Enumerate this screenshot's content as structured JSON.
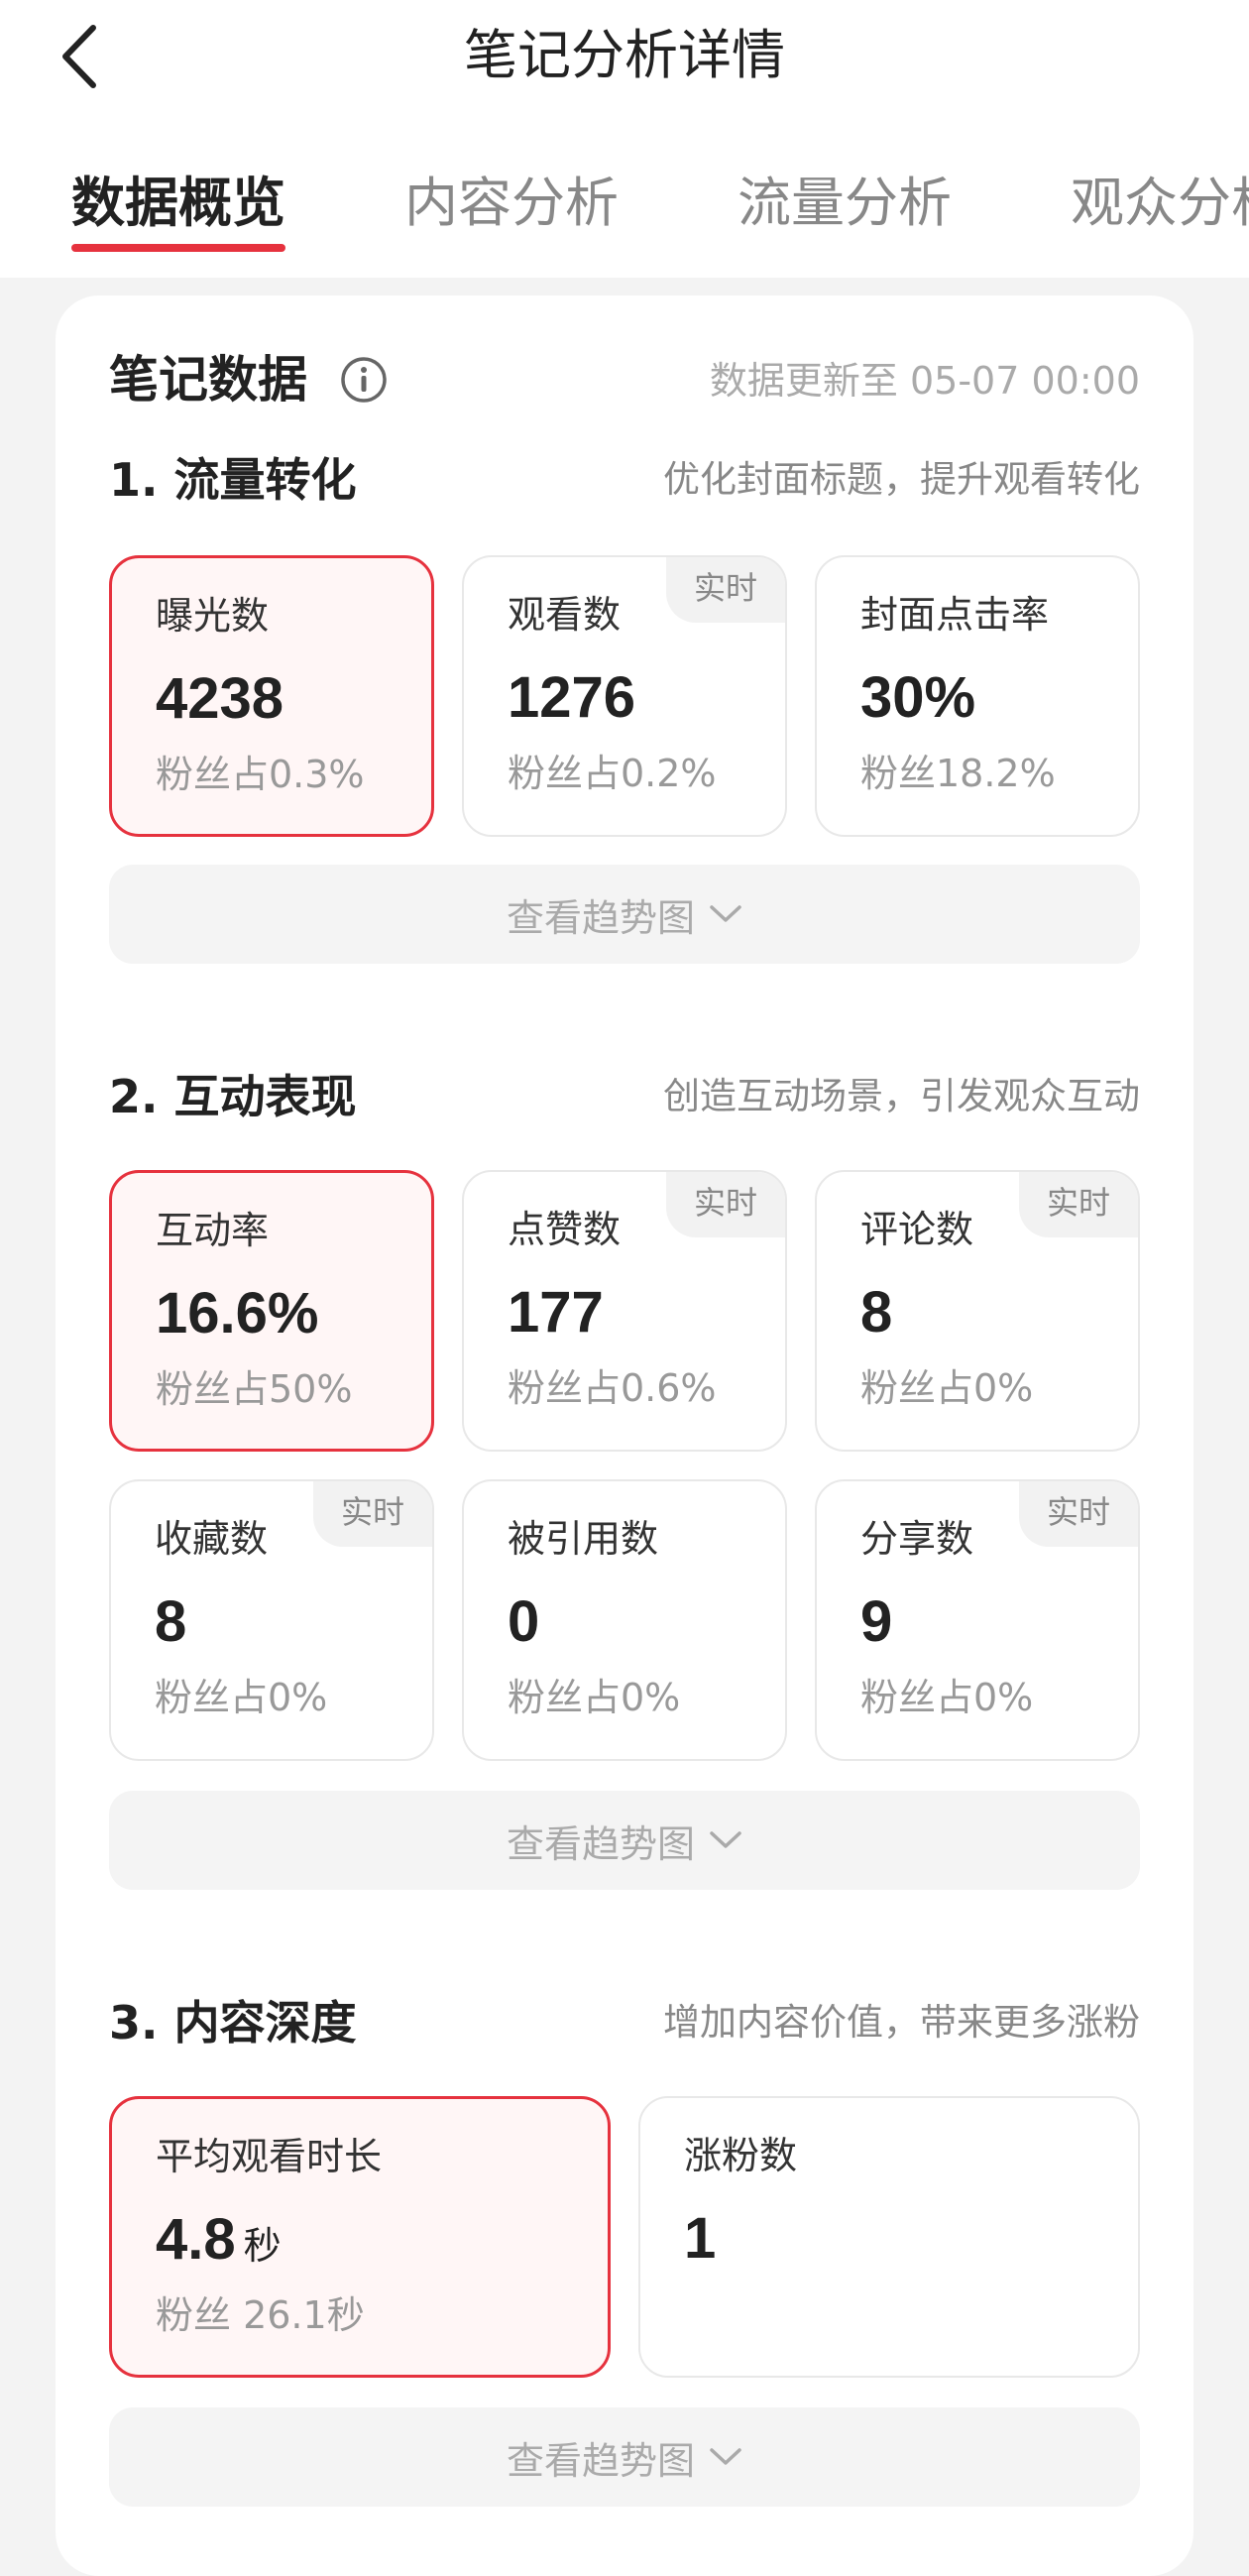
{
  "header": {
    "title": "笔记分析详情"
  },
  "tabs": [
    {
      "label": "数据概览",
      "active": true
    },
    {
      "label": "内容分析",
      "active": false
    },
    {
      "label": "流量分析",
      "active": false
    },
    {
      "label": "观众分析",
      "active": false
    }
  ],
  "card": {
    "title": "笔记数据",
    "update_time": "数据更新至 05-07 00:00"
  },
  "sections": [
    {
      "title": "1. 流量转化",
      "hint": "优化封面标题，提升观看转化",
      "trend_label": "查看趋势图",
      "metrics": [
        {
          "label": "曝光数",
          "value": "4238",
          "sub": "粉丝占0.3%",
          "highlight": true,
          "badge": ""
        },
        {
          "label": "观看数",
          "value": "1276",
          "sub": "粉丝占0.2%",
          "highlight": false,
          "badge": "实时"
        },
        {
          "label": "封面点击率",
          "value": "30%",
          "sub": "粉丝18.2%",
          "highlight": false,
          "badge": ""
        }
      ]
    },
    {
      "title": "2. 互动表现",
      "hint": "创造互动场景，引发观众互动",
      "trend_label": "查看趋势图",
      "metrics": [
        {
          "label": "互动率",
          "value": "16.6%",
          "sub": "粉丝占50%",
          "highlight": true,
          "badge": ""
        },
        {
          "label": "点赞数",
          "value": "177",
          "sub": "粉丝占0.6%",
          "highlight": false,
          "badge": "实时"
        },
        {
          "label": "评论数",
          "value": "8",
          "sub": "粉丝占0%",
          "highlight": false,
          "badge": "实时"
        },
        {
          "label": "收藏数",
          "value": "8",
          "sub": "粉丝占0%",
          "highlight": false,
          "badge": "实时"
        },
        {
          "label": "被引用数",
          "value": "0",
          "sub": "粉丝占0%",
          "highlight": false,
          "badge": ""
        },
        {
          "label": "分享数",
          "value": "9",
          "sub": "粉丝占0%",
          "highlight": false,
          "badge": "实时"
        }
      ]
    },
    {
      "title": "3. 内容深度",
      "hint": "增加内容价值，带来更多涨粉",
      "trend_label": "查看趋势图",
      "metrics": [
        {
          "label": "平均观看时长",
          "value": "4.8",
          "unit": "秒",
          "sub": "粉丝 26.1秒",
          "highlight": true,
          "badge": ""
        },
        {
          "label": "涨粉数",
          "value": "1",
          "sub": "",
          "highlight": false,
          "badge": ""
        }
      ]
    }
  ],
  "colors": {
    "accent": "#e6323e",
    "highlight_bg": "#fff6f6"
  }
}
